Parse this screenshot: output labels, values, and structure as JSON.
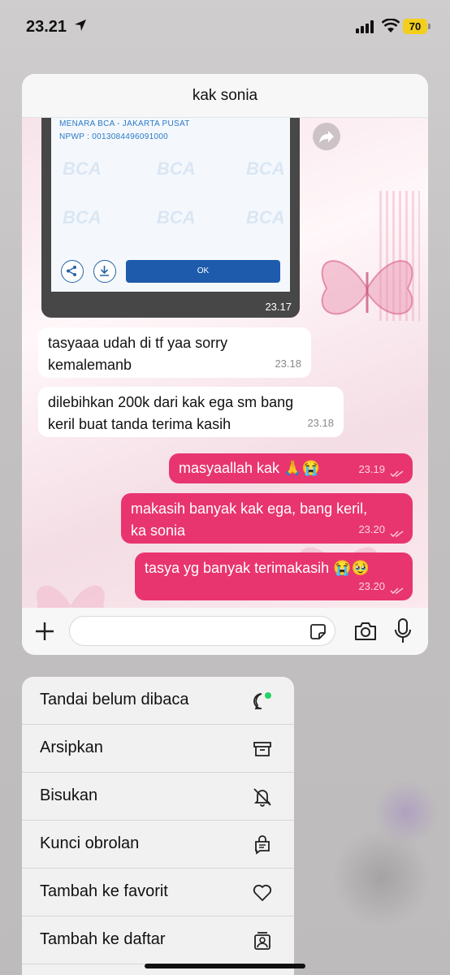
{
  "status_bar": {
    "time": "23.21",
    "battery": "70"
  },
  "chat": {
    "title": "kak sonia",
    "image_message": {
      "receipt_lines": [
        "MENARA BCA - JAKARTA PUSAT",
        "NPWP : 0013084496091000"
      ],
      "watermark": "BCA",
      "ok_label": "OK",
      "time": "23.17"
    },
    "messages": [
      {
        "direction": "in",
        "lines": [
          "tasyaaa udah di tf yaa sorry",
          "kemalemanb"
        ],
        "time": "23.18"
      },
      {
        "direction": "in",
        "lines": [
          "dilebihkan 200k dari kak ega sm bang",
          "keril buat tanda terima kasih"
        ],
        "time": "23.18"
      },
      {
        "direction": "out",
        "lines": [
          "masyaallah kak 🙏😭"
        ],
        "time": "23.19"
      },
      {
        "direction": "out",
        "lines": [
          "makasih banyak kak ega, bang keril,",
          "ka sonia"
        ],
        "time": "23.20"
      },
      {
        "direction": "out",
        "lines": [
          "tasya yg banyak terimakasih 😭🥹"
        ],
        "time": "23.20"
      }
    ]
  },
  "context_menu": [
    {
      "label": "Tandai belum dibaca",
      "icon": "chat-unread-icon"
    },
    {
      "label": "Arsipkan",
      "icon": "archive-icon"
    },
    {
      "label": "Bisukan",
      "icon": "bell-mute-icon"
    },
    {
      "label": "Kunci obrolan",
      "icon": "chat-lock-icon"
    },
    {
      "label": "Tambah ke favorit",
      "icon": "heart-icon"
    },
    {
      "label": "Tambah ke daftar",
      "icon": "list-add-icon"
    }
  ],
  "colors": {
    "outgoing_bubble": "#e8356f",
    "unread_dot": "#25d366",
    "menu_bg": "#f1f1f1"
  }
}
